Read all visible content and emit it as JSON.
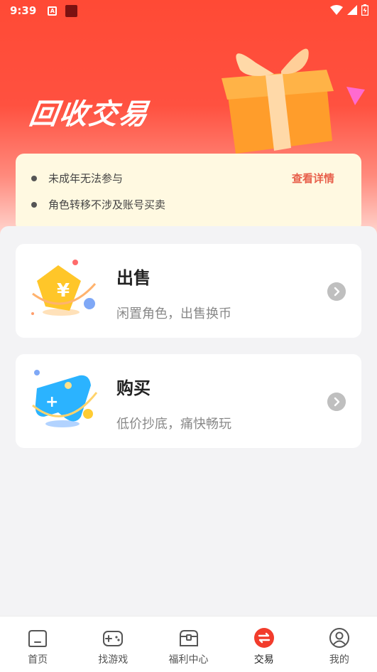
{
  "status_bar": {
    "time": "9:39",
    "a_glyph": "A"
  },
  "hero": {
    "title": "回收交易"
  },
  "notice": {
    "items": [
      "未成年无法参与",
      "角色转移不涉及账号买卖"
    ],
    "detail_link": "查看详情"
  },
  "cards": [
    {
      "title": "出售",
      "subtitle": "闲置角色，出售换币",
      "icon": "sell-tag-icon"
    },
    {
      "title": "购买",
      "subtitle": "低价抄底，痛快畅玩",
      "icon": "gamepad-icon"
    }
  ],
  "tabbar": {
    "tabs": [
      {
        "label": "首页",
        "icon": "home-icon"
      },
      {
        "label": "找游戏",
        "icon": "gamepad-icon"
      },
      {
        "label": "福利中心",
        "icon": "chest-icon"
      },
      {
        "label": "交易",
        "icon": "exchange-icon",
        "active": true
      },
      {
        "label": "我的",
        "icon": "profile-icon"
      }
    ]
  },
  "colors": {
    "accent": "#ff4a35",
    "active_tab": "#f23c2c",
    "notice_bg": "#fff9e1",
    "link": "#e8614c"
  }
}
